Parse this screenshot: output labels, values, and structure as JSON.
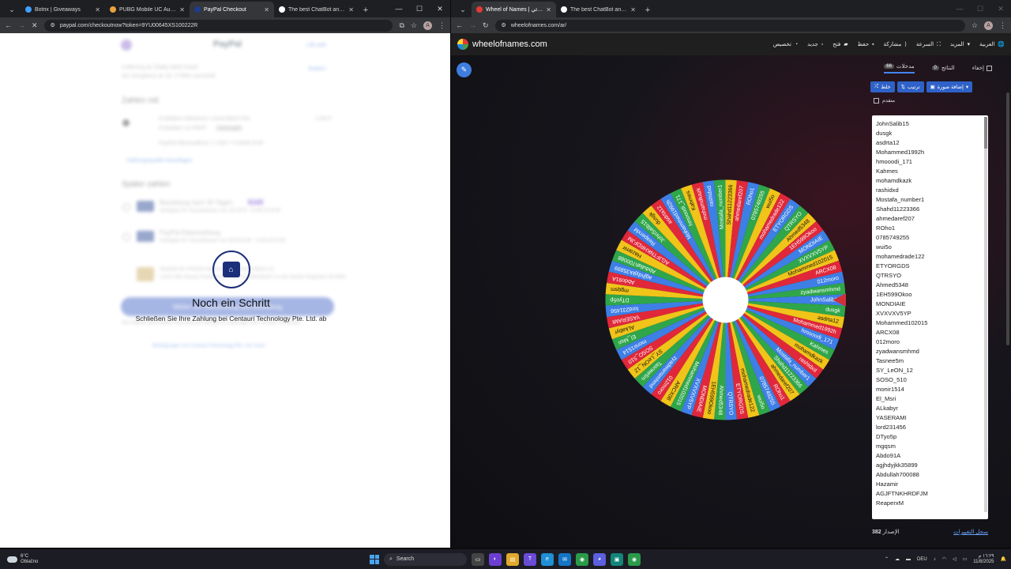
{
  "left": {
    "tabs": [
      {
        "label": "Botrix | Giveaways",
        "color": "#3ea0ff",
        "active": false
      },
      {
        "label": "PUBG Mobile UC Australia",
        "color": "#e9a23b",
        "active": false
      },
      {
        "label": "PayPal Checkout",
        "color": "#1c3d8f",
        "active": true
      },
      {
        "label": "The best ChatBot and Widg",
        "color": "#ffffff",
        "active": false
      }
    ],
    "url": "paypal.com/checkoutnow?token=9YU00645XS100222R",
    "avatar": "A",
    "paypal": {
      "logo": "PayPal",
      "top_right": "Lilli wolt",
      "ship_line1": "Lieferung an Glady-Aktel Imeid",
      "ship_line2": "Am Zeughaus str 16, 27068 Leonsteid",
      "ship_change": "Ändern",
      "pay_with": "Zahlen mit",
      "balance_title": "Guthaben Aktivieren Lemendeich Kto",
      "balance_sub": "Guthaben zu PAPP",
      "balance_tag": "Verknüpft",
      "balance_amount": "0,00 €",
      "balance_line": "PayPal Wechselkurs 1 USD = 0,9336 EUR",
      "add_method": "Zahlungsquelle hinzufügen",
      "later": "Später zahlen",
      "opt1": "Bezahlung nach 30 Tagen",
      "opt1_badge": "NEU",
      "opt1_sub": "Verfügbar für Transaktionen von 100,00 € - 5.000,00 EUR",
      "opt2": "PayPal Ratenzahlung",
      "opt2_sub": "Verfügbar für Transaktionen von 99,00 EUR - 5.000,00 EUR",
      "notice": "Sparplan für Schnell-Lieferung 1 DHL Deutschland a.k.",
      "notice2": "Lorem Mitt Hauses Kontaktinformation an Rekordhaft 2 in den besten Regionen bei Mehr",
      "cta": "Weiter zur Überprüfung und Bestellung",
      "fine1": "Von PayPal übermittelte Informationen werden für Zahlungen bei Centauri verwendet.",
      "fine2": "Bedingungen von Centauri Technology Pte. Ltd. lesen"
    },
    "modal": {
      "title": "Noch ein Schritt",
      "subtitle": "Schließen Sie Ihre Zahlung bei Centauri Technology Pte. Ltd. ab"
    }
  },
  "right": {
    "tabs": [
      {
        "label": "Wheel of Names | اسم العشوائي",
        "color": "#e53935",
        "active": true
      },
      {
        "label": "The best ChatBot and Widgets",
        "color": "#ffffff",
        "active": false
      }
    ],
    "url": "wheelofnames.com/ar/",
    "avatar": "A",
    "site_name": "wheelofnames.com",
    "nav": [
      "العربية",
      "المزيد",
      "السرعة",
      "مشاركة",
      "حفظ",
      "فتح",
      "جديد",
      "تخصيص"
    ],
    "panel": {
      "hide": "إخفاء",
      "results_label": "النتائج",
      "results_count": "0",
      "entries_label": "مدخلات",
      "entries_count": "66",
      "btn_shuffle": "خلط",
      "btn_sort": "ترتيب",
      "btn_image": "إضافة صورة",
      "advanced": "متقدم",
      "version_label": "الإصدار",
      "version": "382",
      "changelog": "سجل التغييرات"
    },
    "entries": [
      "JohnSalib15",
      "dusgk",
      "asdrta12",
      "Mohammed1992h",
      "hmooodi_171",
      "Kahmes",
      "mohamdkazk",
      "rashidxd",
      "Mostafa_number1",
      "Shahd11223366",
      "ahmedaref207",
      "ROho1",
      "0785749255",
      "wui5o",
      "mohamedrade122",
      "ETYORGDS",
      "QTRSYO",
      "Ahmed5348",
      "1EH599Okoo",
      "MONDIAIE",
      "XVXVXV5YP",
      "Mohammed102015",
      "ARCX08",
      "012moro",
      "zyadwansmhmd",
      "Tasnee5m",
      "SY_LeON_12",
      "SOSO_510",
      "monir1514",
      "El_Msri",
      "ALkabyr",
      "YASERAMI",
      "lord231456",
      "DTyo5p",
      "mgqsm",
      "Abdo91A",
      "agjhdyjkk35899",
      "Abdullah700088",
      "Hazamir",
      "AGJFTNKHRDFJM",
      "ReaperxM"
    ],
    "wheel_colors": [
      "#3e7fe6",
      "#2fa64a",
      "#f0c419",
      "#e0283a"
    ]
  },
  "taskbar": {
    "temp": "6°C",
    "weather": "Oblačno",
    "search": "Search",
    "lang": "DEU",
    "time": "١٦:٢٩ م",
    "date": "11/8/2025"
  }
}
